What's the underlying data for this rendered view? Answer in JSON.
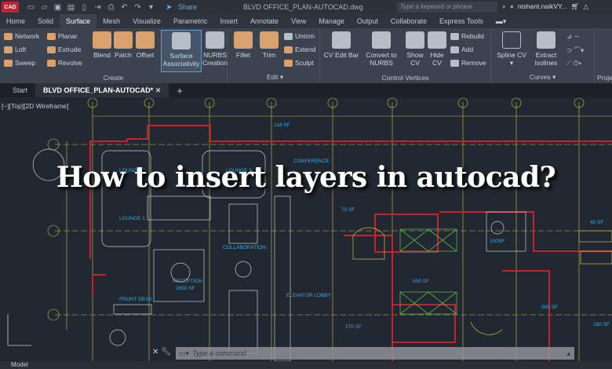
{
  "titlebar": {
    "app_badge": "CAD",
    "share": "Share",
    "document_title": "BLVD OFFICE_PLAN-AUTOCAD.dwg",
    "search_placeholder": "Type a keyword or phrase",
    "user": "nishant.naikVY..."
  },
  "ribbon_tabs": [
    {
      "label": "Home"
    },
    {
      "label": "Solid"
    },
    {
      "label": "Surface",
      "active": true
    },
    {
      "label": "Mesh"
    },
    {
      "label": "Visualize"
    },
    {
      "label": "Parametric"
    },
    {
      "label": "Insert"
    },
    {
      "label": "Annotate"
    },
    {
      "label": "View"
    },
    {
      "label": "Manage"
    },
    {
      "label": "Output"
    },
    {
      "label": "Collaborate"
    },
    {
      "label": "Express Tools"
    }
  ],
  "ribbon": {
    "create": {
      "label": "Create",
      "network": "Network",
      "planar": "Planar",
      "loft": "Loft",
      "extrude": "Extrude",
      "sweep": "Sweep",
      "revolve": "Revolve",
      "blend": "Blend",
      "patch": "Patch",
      "offset": "Offset",
      "surface_assoc_1": "Surface",
      "surface_assoc_2": "Associativity",
      "nurbs_1": "NURBS",
      "nurbs_2": "Creation"
    },
    "edit": {
      "label": "Edit",
      "fillet": "Fillet",
      "trim": "Trim",
      "untrim": "Untrim",
      "extend": "Extend",
      "sculpt": "Sculpt"
    },
    "cv": {
      "label": "Control Vertices",
      "cv_edit_bar": "CV Edit Bar",
      "convert_1": "Convert to",
      "convert_2": "NURBS",
      "show_1": "Show",
      "show_2": "CV",
      "hide_1": "Hide",
      "hide_2": "CV",
      "rebuild": "Rebuild",
      "add": "Add",
      "remove": "Remove"
    },
    "curves": {
      "label": "Curves",
      "spline_cv": "Spline CV",
      "extract_1": "Extract",
      "extract_2": "Isolines"
    },
    "project": {
      "label": "Proje"
    }
  },
  "doc_tabs": {
    "start": "Start",
    "active": "BLVD OFFICE_PLAN-AUTOCAD*"
  },
  "viewport": {
    "label": "[−][Top][2D Wireframe]"
  },
  "plan_labels": {
    "sf118": "118 SF",
    "lounge2": "LOUNGE 2",
    "lounge3": "LOUNGE 3",
    "conference": "CONFERENCE",
    "lounge1": "LOUNGE 1",
    "collab": "COLLABORATION",
    "reception": "RECEPTION",
    "reception_sf": "2650 SF",
    "front_desk": "FRONT DESK",
    "elevator": "ELEVATOR LOBBY",
    "sf50": "50 SF",
    "sf70": "70 SF",
    "sf100": "100SF",
    "sf500": "500 SF",
    "sf595": "595 SF",
    "sf170": "170 SF",
    "sf40": "40 SF",
    "sf160": "160 SF"
  },
  "headline": "How to insert layers in autocad?",
  "command": {
    "placeholder": "Type a command"
  },
  "status": {
    "model": "Model"
  },
  "colors": {
    "accent": "#6aa8e0",
    "walls": "#c8202e",
    "grid": "#c8c04a",
    "labels": "#3fa9d8",
    "background": "#222831"
  }
}
